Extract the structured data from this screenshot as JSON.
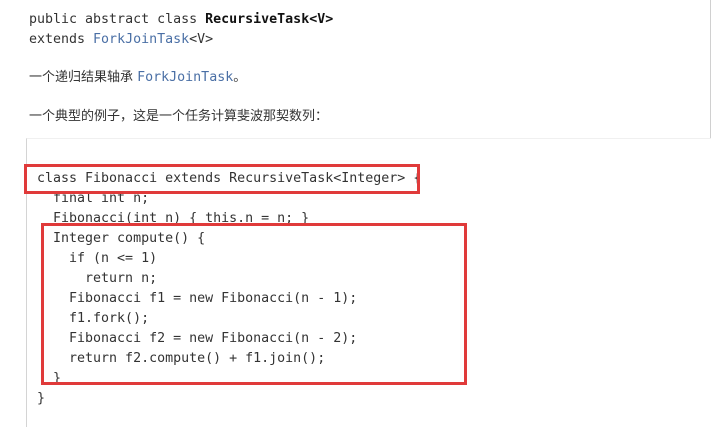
{
  "signature": {
    "line1_prefix": "public abstract class ",
    "line1_class": "RecursiveTask<V>",
    "line2_prefix": "extends ",
    "line2_link": "ForkJoinTask",
    "line2_suffix": "<V>"
  },
  "description": {
    "prefix": "一个递归结果轴承 ",
    "link": "ForkJoinTask",
    "suffix": "。"
  },
  "example_intro": "一个典型的例子，这是一个任务计算斐波那契数列：",
  "code_lines": [
    "class Fibonacci extends RecursiveTask<Integer> {",
    "  final int n;",
    "  Fibonacci(int n) { this.n = n; }",
    "  Integer compute() {",
    "    if (n <= 1)",
    "      return n;",
    "    Fibonacci f1 = new Fibonacci(n - 1);",
    "    f1.fork();",
    "    Fibonacci f2 = new Fibonacci(n - 2);",
    "    return f2.compute() + f1.join();",
    "  }",
    "}"
  ],
  "highlight_color": "#e03a3a"
}
